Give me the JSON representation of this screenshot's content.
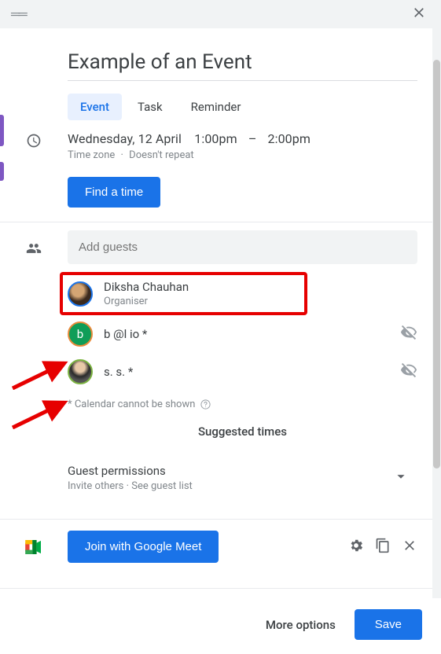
{
  "header": {
    "drag": "══"
  },
  "title": "Example of an Event",
  "tabs": {
    "event": "Event",
    "task": "Task",
    "reminder": "Reminder"
  },
  "datetime": {
    "date": "Wednesday, 12 April",
    "start": "1:00pm",
    "sep": "–",
    "end": "2:00pm",
    "timezone": "Time zone",
    "repeat": "Doesn't repeat"
  },
  "buttons": {
    "find_time": "Find a time",
    "join_meet": "Join with Google Meet",
    "more_options": "More options",
    "save": "Save"
  },
  "guests": {
    "placeholder": "Add guests",
    "list": [
      {
        "name": "Diksha Chauhan",
        "role": "Organiser"
      },
      {
        "name": "b    @l     io *",
        "role": ""
      },
      {
        "name": "s. s. *",
        "role": ""
      }
    ],
    "footnote": "* Calendar cannot be shown",
    "suggested": "Suggested times"
  },
  "permissions": {
    "title": "Guest permissions",
    "sub_invite": "Invite others",
    "sub_see": "See guest list"
  },
  "avatars": {
    "letter_b": "b"
  }
}
